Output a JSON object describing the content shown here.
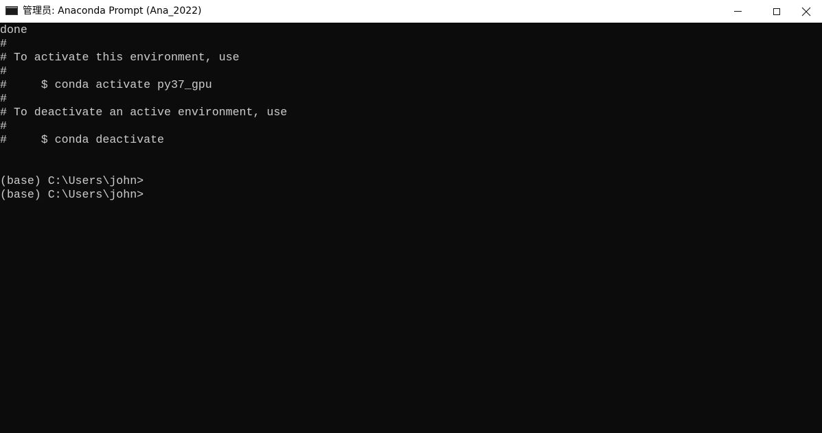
{
  "window": {
    "title": "管理员: Anaconda Prompt (Ana_2022)"
  },
  "icons": {
    "app": "console-window-icon",
    "minimize": "minimize-icon",
    "maximize": "maximize-icon",
    "close": "close-icon"
  },
  "colors": {
    "console_background": "#0c0c0c",
    "console_text": "#cccccc",
    "titlebar_background": "#ffffff"
  },
  "console": {
    "lines": [
      "done",
      "#",
      "# To activate this environment, use",
      "#",
      "#     $ conda activate py37_gpu",
      "#",
      "# To deactivate an active environment, use",
      "#",
      "#     $ conda deactivate",
      "",
      "",
      "(base) C:\\Users\\john>",
      "(base) C:\\Users\\john>"
    ]
  }
}
